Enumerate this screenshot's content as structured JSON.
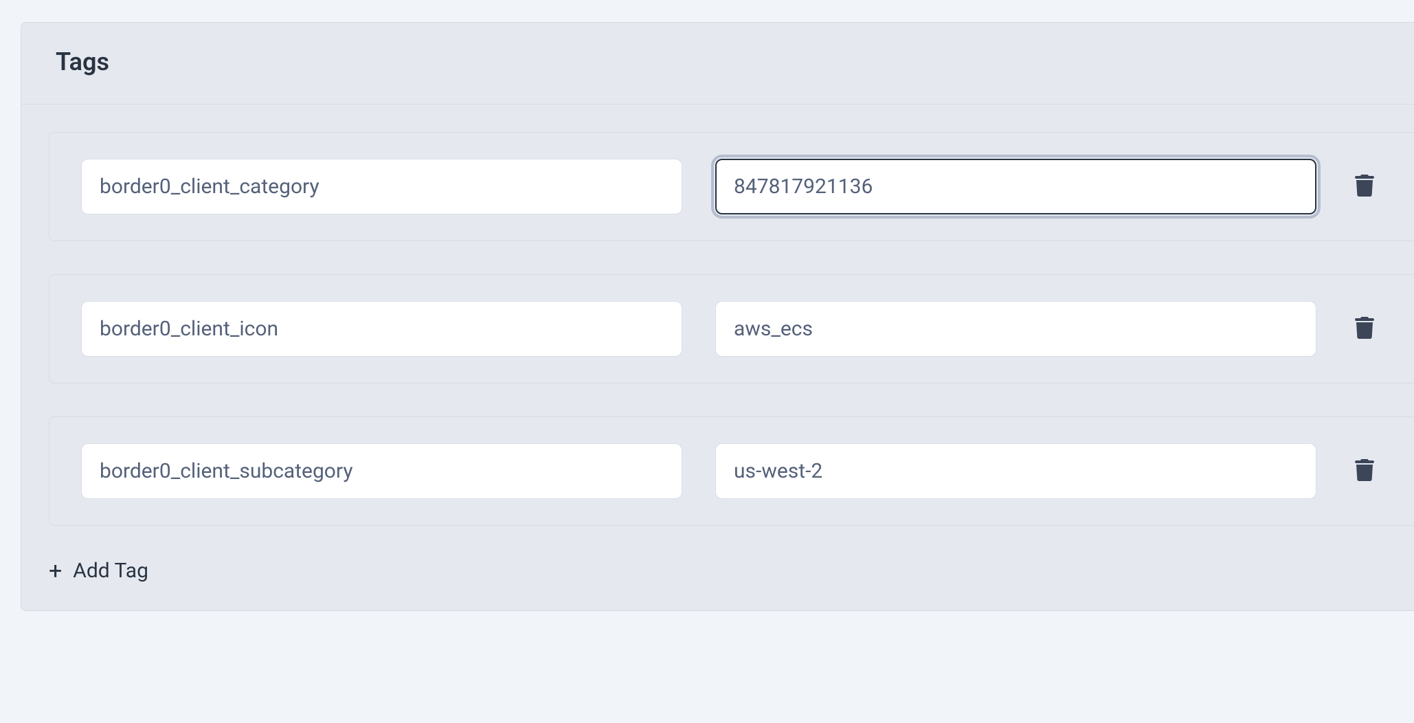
{
  "panel": {
    "title": "Tags"
  },
  "tags": [
    {
      "key": "border0_client_category",
      "value": "847817921136",
      "focused": true
    },
    {
      "key": "border0_client_icon",
      "value": "aws_ecs",
      "focused": false
    },
    {
      "key": "border0_client_subcategory",
      "value": "us-west-2",
      "focused": false
    }
  ],
  "actions": {
    "add_tag_label": "Add Tag"
  }
}
